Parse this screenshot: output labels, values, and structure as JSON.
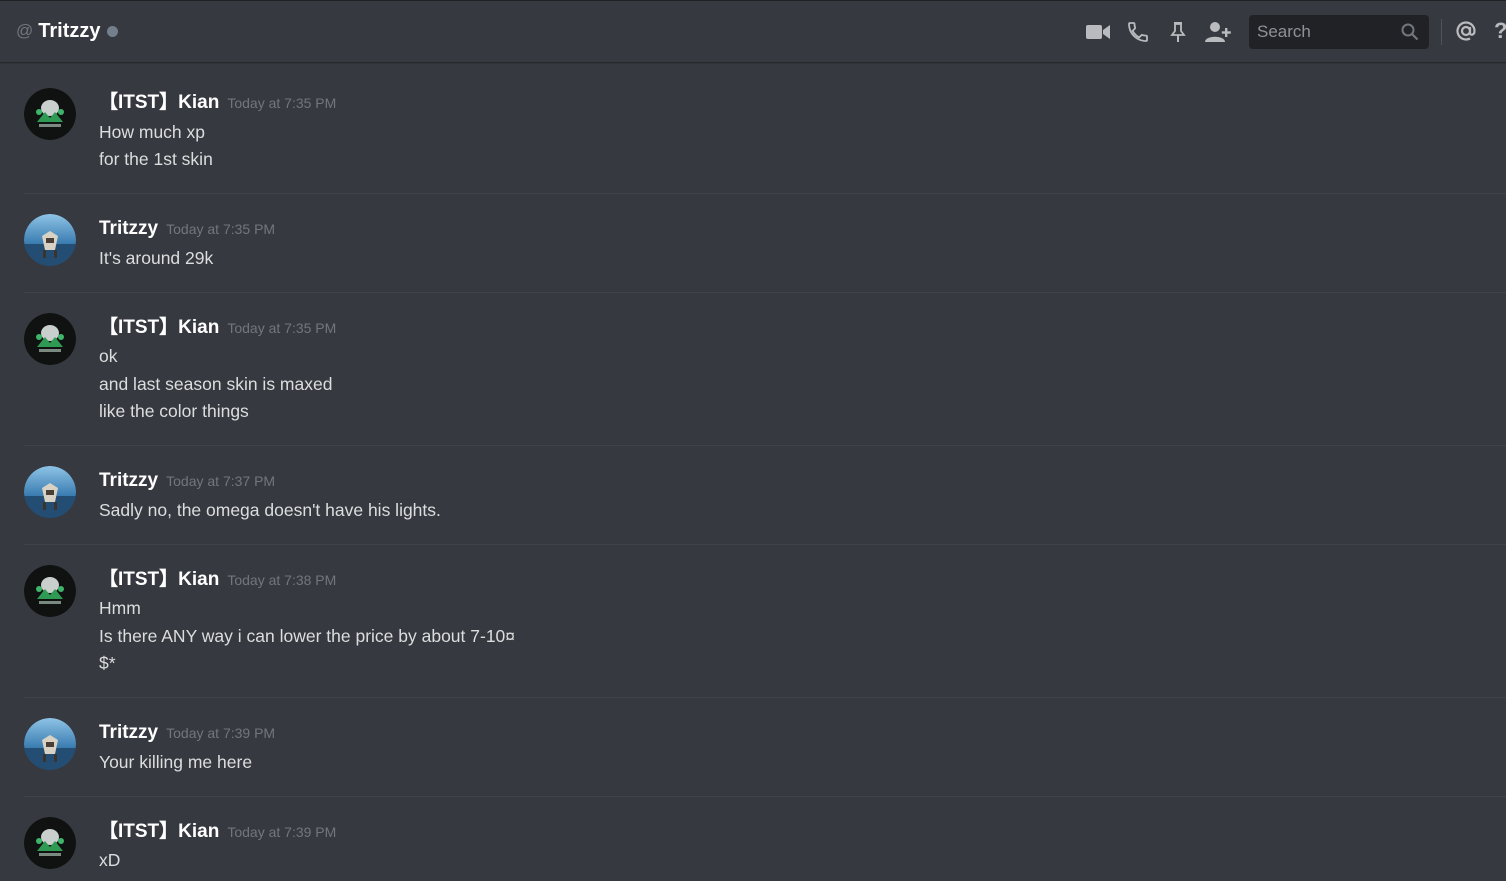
{
  "header": {
    "at_symbol": "@",
    "dm_name": "Tritzzy",
    "status": "offline",
    "search_placeholder": "Search",
    "help_glyph": "?",
    "icons": [
      "video-call-icon",
      "voice-call-icon",
      "pin-icon",
      "add-friend-icon",
      "search-icon",
      "mention-icon",
      "help-icon"
    ]
  },
  "messages": [
    {
      "author": "【ITST】Kian",
      "time": "Today at 7:35 PM",
      "avatar": "kian-avatar",
      "lines": [
        "How much xp",
        "for the 1st skin"
      ]
    },
    {
      "author": "Tritzzy",
      "time": "Today at 7:35 PM",
      "avatar": "tritzzy-avatar",
      "lines": [
        "It's around 29k"
      ]
    },
    {
      "author": "【ITST】Kian",
      "time": "Today at 7:35 PM",
      "avatar": "kian-avatar",
      "lines": [
        "ok",
        "and last season skin is maxed",
        "like the color things"
      ]
    },
    {
      "author": "Tritzzy",
      "time": "Today at 7:37 PM",
      "avatar": "tritzzy-avatar",
      "lines": [
        "Sadly no, the omega doesn't have his lights."
      ]
    },
    {
      "author": "【ITST】Kian",
      "time": "Today at 7:38 PM",
      "avatar": "kian-avatar",
      "lines": [
        "Hmm",
        "Is there ANY way i can lower the price by about 7-10¤",
        "$*"
      ]
    },
    {
      "author": "Tritzzy",
      "time": "Today at 7:39 PM",
      "avatar": "tritzzy-avatar",
      "lines": [
        "Your killing me here"
      ]
    },
    {
      "author": "【ITST】Kian",
      "time": "Today at 7:39 PM",
      "avatar": "kian-avatar",
      "lines": [
        "xD"
      ]
    }
  ],
  "colors": {
    "background": "#36393f",
    "text": "#dcddde",
    "username": "#ffffff",
    "timestamp": "#72767d",
    "icon": "#b9bbbe",
    "search_bg": "#202225"
  }
}
